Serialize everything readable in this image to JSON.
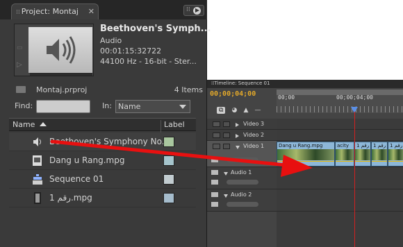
{
  "project_panel": {
    "tab_label": "Project: Montaj",
    "clip_info": {
      "title": "Beethoven's Symph...",
      "type": "Audio",
      "duration": "00:01:15:32722",
      "format": "44100 Hz - 16-bit - Ster..."
    },
    "project_file": "Montaj.prproj",
    "item_count": "4 Items",
    "find_label": "Find:",
    "find_value": "",
    "in_label": "In:",
    "in_value": "Name",
    "columns": {
      "name": "Name",
      "label": "Label"
    },
    "items": [
      {
        "name": "Beethoven's Symphony No.",
        "icon": "audio-speaker-icon",
        "label_color": "#a9c79f"
      },
      {
        "name": "Dang u Rang.mpg",
        "icon": "video-clip-icon",
        "label_color": "#a5c4cc"
      },
      {
        "name": "Sequence 01",
        "icon": "sequence-icon",
        "label_color": "#c2ccd0"
      },
      {
        "name": "1 رقم.mpg",
        "icon": "film-strip-icon",
        "label_color": "#a5bccc"
      }
    ]
  },
  "timeline_panel": {
    "tab_label": "Timeline: Sequence 01",
    "timecode": "00;00;04;00",
    "ruler_labels": [
      "00;00",
      "00;00;04;00"
    ],
    "tracks": [
      {
        "name": "Video 3"
      },
      {
        "name": "Video 2"
      },
      {
        "name": "Video 1"
      },
      {
        "name": "Audio 1"
      },
      {
        "name": "Audio 2"
      }
    ],
    "clips": [
      {
        "title": "Dang u Rang.mpg"
      },
      {
        "title": "acity"
      },
      {
        "title": "رقم 1"
      },
      {
        "title": "رقم 1"
      },
      {
        "title": "رقم 1"
      }
    ]
  },
  "annotation": {
    "arrow_color": "#e81010"
  },
  "colors": {
    "timecode": "#e3a92a",
    "playhead": "#d42020",
    "clip_blue": "#8db7d8"
  }
}
